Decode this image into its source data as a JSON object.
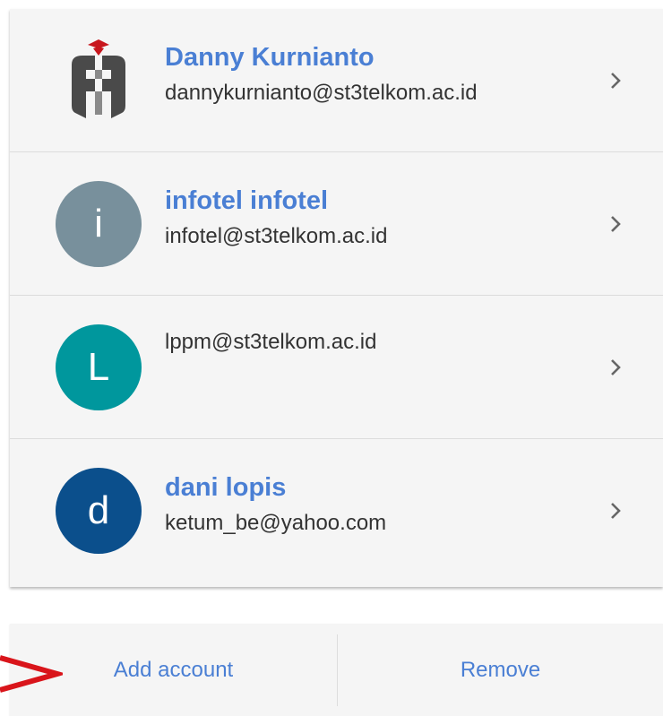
{
  "accounts": [
    {
      "name": "Danny Kurnianto",
      "email": "dannykurnianto@st3telkom.ac.id",
      "avatar_type": "logo",
      "avatar_letter": "",
      "avatar_color": ""
    },
    {
      "name": "infotel infotel",
      "email": "infotel@st3telkom.ac.id",
      "avatar_type": "letter",
      "avatar_letter": "i",
      "avatar_color": "#78909c"
    },
    {
      "name": "",
      "email": "lppm@st3telkom.ac.id",
      "avatar_type": "letter",
      "avatar_letter": "L",
      "avatar_color": "#00979d"
    },
    {
      "name": "dani lopis",
      "email": "ketum_be@yahoo.com",
      "avatar_type": "letter",
      "avatar_letter": "d",
      "avatar_color": "#0b4f8c"
    }
  ],
  "actions": {
    "add_label": "Add account",
    "remove_label": "Remove"
  },
  "colors": {
    "link_blue": "#4a7fd4",
    "panel_bg": "#f5f5f5",
    "annotation_red": "#d9151b",
    "logo_gray": "#4a4a4a",
    "logo_red": "#c8161d"
  }
}
